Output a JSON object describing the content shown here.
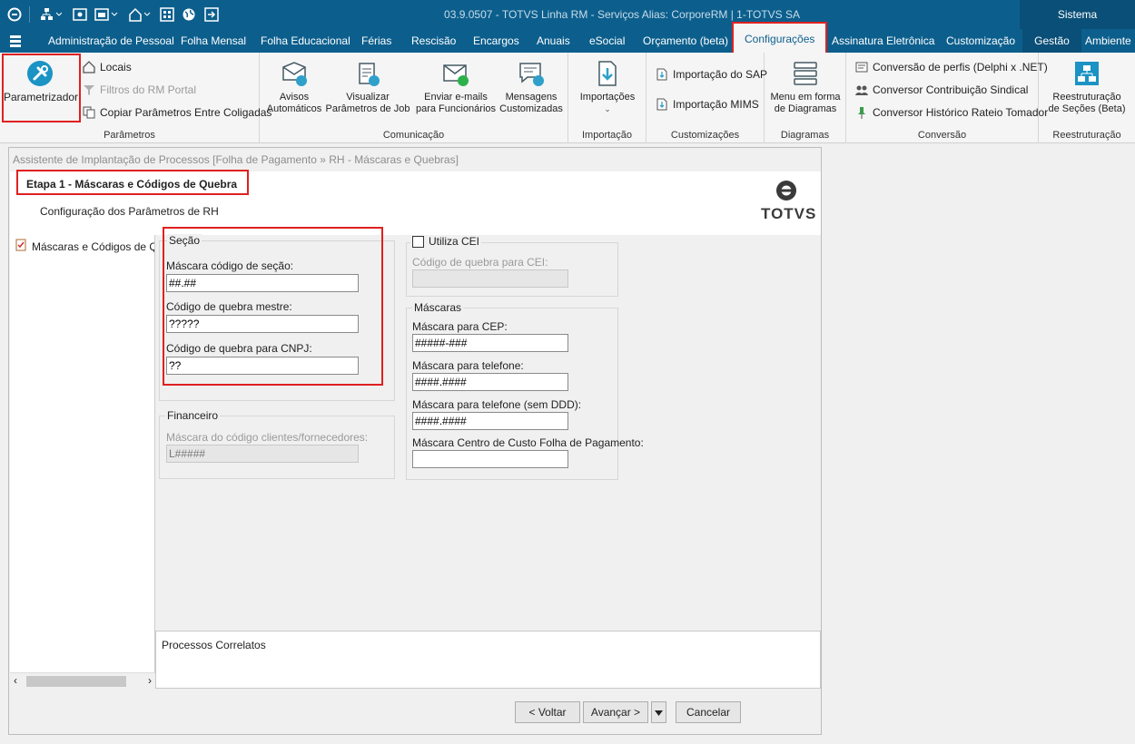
{
  "titlebar": {
    "title": "03.9.0507 - TOTVS Linha RM - Serviços  Alias: CorporeRM | 1-TOTVS SA",
    "system_label": "Sistema"
  },
  "menu": {
    "tabs": [
      {
        "label": "Administração de Pessoal"
      },
      {
        "label": "Folha Mensal"
      },
      {
        "label": "Folha Educacional"
      },
      {
        "label": "Férias"
      },
      {
        "label": "Rescisão"
      },
      {
        "label": "Encargos"
      },
      {
        "label": "Anuais"
      },
      {
        "label": "eSocial"
      },
      {
        "label": "Orçamento (beta)"
      },
      {
        "label": "Configurações"
      },
      {
        "label": "Assinatura Eletrônica"
      },
      {
        "label": "Customização"
      },
      {
        "label": "Gestão"
      },
      {
        "label": "Ambiente"
      }
    ]
  },
  "ribbon": {
    "parametros": {
      "label": "Parâmetros",
      "parametrizador": "Parametrizador",
      "locais": "Locais",
      "filtros": "Filtros do RM Portal",
      "copiar": "Copiar Parâmetros Entre Coligadas"
    },
    "comunicacao": {
      "label": "Comunicação",
      "avisos_1": "Avisos",
      "avisos_2": "Automáticos",
      "visualizar_1": "Visualizar",
      "visualizar_2": "Parâmetros de Job",
      "enviar_1": "Enviar e-mails",
      "enviar_2": "para Funcionários",
      "mensagens_1": "Mensagens",
      "mensagens_2": "Customizadas"
    },
    "importacao": {
      "label": "Importação",
      "btn": "Importações"
    },
    "customizacoes": {
      "label": "Customizações",
      "sap": "Importação do SAP",
      "mims": "Importação MIMS"
    },
    "diagramas": {
      "label": "Diagramas",
      "btn_1": "Menu em forma",
      "btn_2": "de Diagramas"
    },
    "conversao": {
      "label": "Conversão",
      "perfis": "Conversão de perfis (Delphi x .NET)",
      "sindical": "Conversor Contribuição Sindical",
      "rateio": "Conversor Histórico Rateio Tomador"
    },
    "reestruturacao": {
      "label": "Reestruturação",
      "btn_1": "Reestruturação",
      "btn_2": "de Seções (Beta)"
    }
  },
  "wizard": {
    "window_title": "Assistente de Implantação de Processos [Folha de Pagamento » RH - Máscaras e Quebras]",
    "step_title": "Etapa 1 - Máscaras e Códigos de Quebra",
    "step_subtitle": "Configuração dos Parâmetros de RH",
    "logo_text": "TOTVS",
    "tree_item": "Máscaras e Códigos de Quebra",
    "secao": {
      "legend": "Seção",
      "mascara_label": "Máscara código de seção:",
      "mascara_value": "##.##",
      "mestre_label": "Código de quebra mestre:",
      "mestre_value": "?????",
      "cnpj_label": "Código de quebra para CNPJ:",
      "cnpj_value": "??"
    },
    "financeiro": {
      "legend": "Financeiro",
      "label": "Máscara do código clientes/fornecedores:",
      "value": "L#####"
    },
    "cei": {
      "checkbox_label": "Utiliza CEI",
      "label": "Código de quebra para CEI:",
      "value": ""
    },
    "mascaras": {
      "legend": "Máscaras",
      "cep_label": "Máscara para CEP:",
      "cep_value": "#####-###",
      "tel_label": "Máscara para telefone:",
      "tel_value": "####.####",
      "telsd_label": "Máscara para telefone (sem DDD):",
      "telsd_value": "####.####",
      "cc_label": "Máscara Centro de Custo Folha de Pagamento:",
      "cc_value": ""
    },
    "related": "Processos Correlatos",
    "buttons": {
      "back": "< Voltar",
      "next": "Avançar >",
      "cancel": "Cancelar"
    }
  },
  "colors": {
    "brand": "#0c5f8d",
    "highlight": "#e02020"
  }
}
